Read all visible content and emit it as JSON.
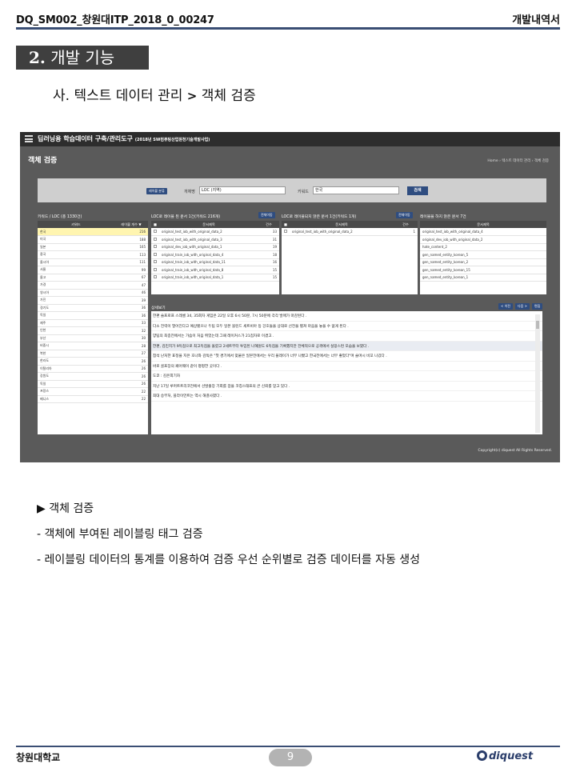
{
  "header": {
    "doc_id": "DQ_SM002_창원대ITP_2018_0_00247",
    "doc_type": "개발내역서"
  },
  "section": {
    "number": "2.",
    "title": "개발 기능"
  },
  "subsection": {
    "prefix": "사. 텍스트 데이터 관리",
    "arrow": ">",
    "target": "객체 검증"
  },
  "screenshot": {
    "app_title": "딥러닝용 학습데이터 구축/관리도구",
    "app_subtitle": "(2018년 SW컴퓨팅산업원천기술개발사업)",
    "page_title": "객체 검증",
    "breadcrumb": "Home › 텍스트 데이터 관리 › 객체 검증",
    "search": {
      "btn_small": "레이블 분류",
      "name_label": "개체명",
      "name_value": "LOC (지역)",
      "keyword_label": "키워드",
      "keyword_value": "한국",
      "search_btn": "검색"
    },
    "panel_titles": {
      "p1": "키워드 / LOC (총 1330건)",
      "p2": "LOC로 레이블 된 문서 1건(키워드 216개)",
      "p3": "LOC로 레이블되지 않은 문서 1건(키워드 1개)",
      "p4": "레이블을 하지 않은 문서 7건",
      "all_btn": "전체이동"
    },
    "kw_table": {
      "headers": [
        "키워드",
        "레이블 개수 ▼"
      ],
      "rows": [
        [
          "한국",
          "216"
        ],
        [
          "미국",
          "188"
        ],
        [
          "일본",
          "165"
        ],
        [
          "중국",
          "113"
        ],
        [
          "올시아",
          "111"
        ],
        [
          "서울",
          "99"
        ],
        [
          "몰고",
          "67"
        ],
        [
          "가경",
          "47"
        ],
        [
          "영시아",
          "46"
        ],
        [
          "가진",
          "39"
        ],
        [
          "경기도",
          "36"
        ],
        [
          "독일",
          "36"
        ],
        [
          "제주",
          "33"
        ],
        [
          "인천",
          "32"
        ],
        [
          "부산",
          "30"
        ],
        [
          "비중시",
          "28"
        ],
        [
          "북한",
          "27"
        ],
        [
          "한라도",
          "26"
        ],
        [
          "이탈리아",
          "26"
        ],
        [
          "강원도",
          "26"
        ],
        [
          "독일",
          "26"
        ],
        [
          "프랑스",
          "22"
        ],
        [
          "베니스",
          "22"
        ]
      ]
    },
    "labeled_table": {
      "headers": [
        "■",
        "문서제목",
        "건수"
      ],
      "rows": [
        [
          "original_test_iob_with_original_data_2",
          "33"
        ],
        [
          "original_test_iob_with_original_data_3",
          "31"
        ],
        [
          "original_dev_iob_with_original_data_1",
          "19"
        ],
        [
          "original_train_iob_with_original_data_4",
          "18"
        ],
        [
          "original_train_iob_with_original_data_11",
          "16"
        ],
        [
          "original_train_iob_with_original_data_8",
          "15"
        ],
        [
          "original_train_iob_with_original_data_1",
          "15"
        ]
      ]
    },
    "unlabeled_table": {
      "headers": [
        "■",
        "문서제목",
        "건수"
      ],
      "rows": [
        [
          "original_test_iob_with_original_data_2",
          "1"
        ]
      ]
    },
    "nolabel_table": {
      "headers": [
        "문서제목"
      ],
      "rows": [
        "original_test_iob_with_original_data_4",
        "original_dev_iob_with_original_data_2",
        "hate_content_2",
        "gen_named_entity_korean_5",
        "gen_named_entity_korean_2",
        "gen_named_entity_korean_15",
        "gen_named_entity_korean_1"
      ]
    },
    "detail": {
      "title": "상세보기",
      "prev": "< 이전",
      "next": "다음 >",
      "edit": "편집",
      "lines": [
        "한편 슬프로프 스레셀 34, 35회차 게임은 22일 오후 6시 50분, 7시 50분에 각각 발매가 마감된다 .",
        "다소 전력이 열어진다고 예상됐으나 두팀 모두 일본 블린드 세트비아 등 강호들을 상대로 선전을 펼쳐 마음을 놓을 수 없게 된다 .",
        "양팀의 최종전에서는 가슴이 처음 뛰었는데 그때 레이커스가 21점차로 이겼고 .",
        "한편, 김민지가 9득점으로 최고득점을 올렸고 2세트부터 투입된 나혜원도 6득점을 기록했지만 전체적으로 공격에서 실망스런 모습을 보였다 .",
        "참석 난처한 표정을 지은 호나와 감독은 \"첫 경기에서 맞붙은 일본전에서는 우리 플레이가 너무 나빴고 한국전에서는 너무 좋았다\"며 슬며시 비꼬 나갔다 .",
        "바로 골프장의 페어웨이 같이 평평한 곳이다 .",
        "도쿄 : 김은희기자",
        "지난 17일 루머트트리코전에서 선발출장 기회를 잡을 코칭스태프의 큰 신뢰를 얻고 있다 .",
        "최대 승부처, 블라이언트는 역시 해결사였다 ."
      ]
    },
    "copyright": "Copyright(c) diquest All Rights Reserved."
  },
  "bullets": [
    "▶ 객체 검증",
    "- 객체에 부여된 레이블링 태그 검증",
    "- 레이블링 데이터의 통계를 이용하여 검증 우선 순위별로 검증 데이터를 자동 생성"
  ],
  "footer": {
    "left": "창원대학교",
    "page": "9",
    "logo": "diquest"
  }
}
